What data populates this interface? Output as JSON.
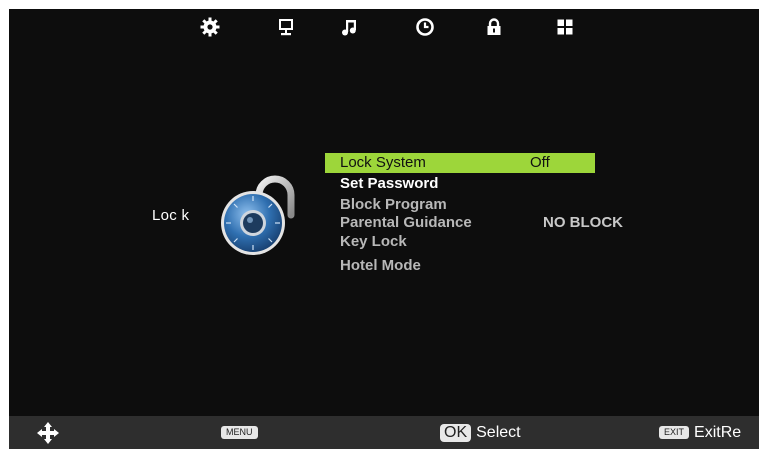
{
  "colors": {
    "background": "#0d0d0d",
    "highlight": "#9dd63a",
    "bottom_bar": "#2e2e2e",
    "lock_blue": "#2f6fb0"
  },
  "top_tabs": [
    {
      "icon": "gear-icon"
    },
    {
      "icon": "monitor-icon"
    },
    {
      "icon": "music-note-icon"
    },
    {
      "icon": "clock-icon"
    },
    {
      "icon": "padlock-icon",
      "active": true
    },
    {
      "icon": "grid-icon"
    }
  ],
  "section": {
    "label": "Loc k",
    "icon": "combination-lock-icon"
  },
  "menu": {
    "lock_system": {
      "label": "Lock System",
      "value": "Off"
    },
    "set_password": {
      "label": "Set Password"
    },
    "block_program": {
      "label": "Block Program"
    },
    "parental_guidance": {
      "label": "Parental Guidance",
      "value": "NO BLOCK"
    },
    "key_lock": {
      "label": "Key Lock"
    },
    "hotel_mode": {
      "label": "Hotel Mode"
    }
  },
  "bottom_bar": {
    "navigate_icon": "four-way-arrows-icon",
    "menu_key": "MENU",
    "ok_key": "OK",
    "ok_label": "Select",
    "exit_key": "EXIT",
    "exit_label": "ExitRe"
  }
}
